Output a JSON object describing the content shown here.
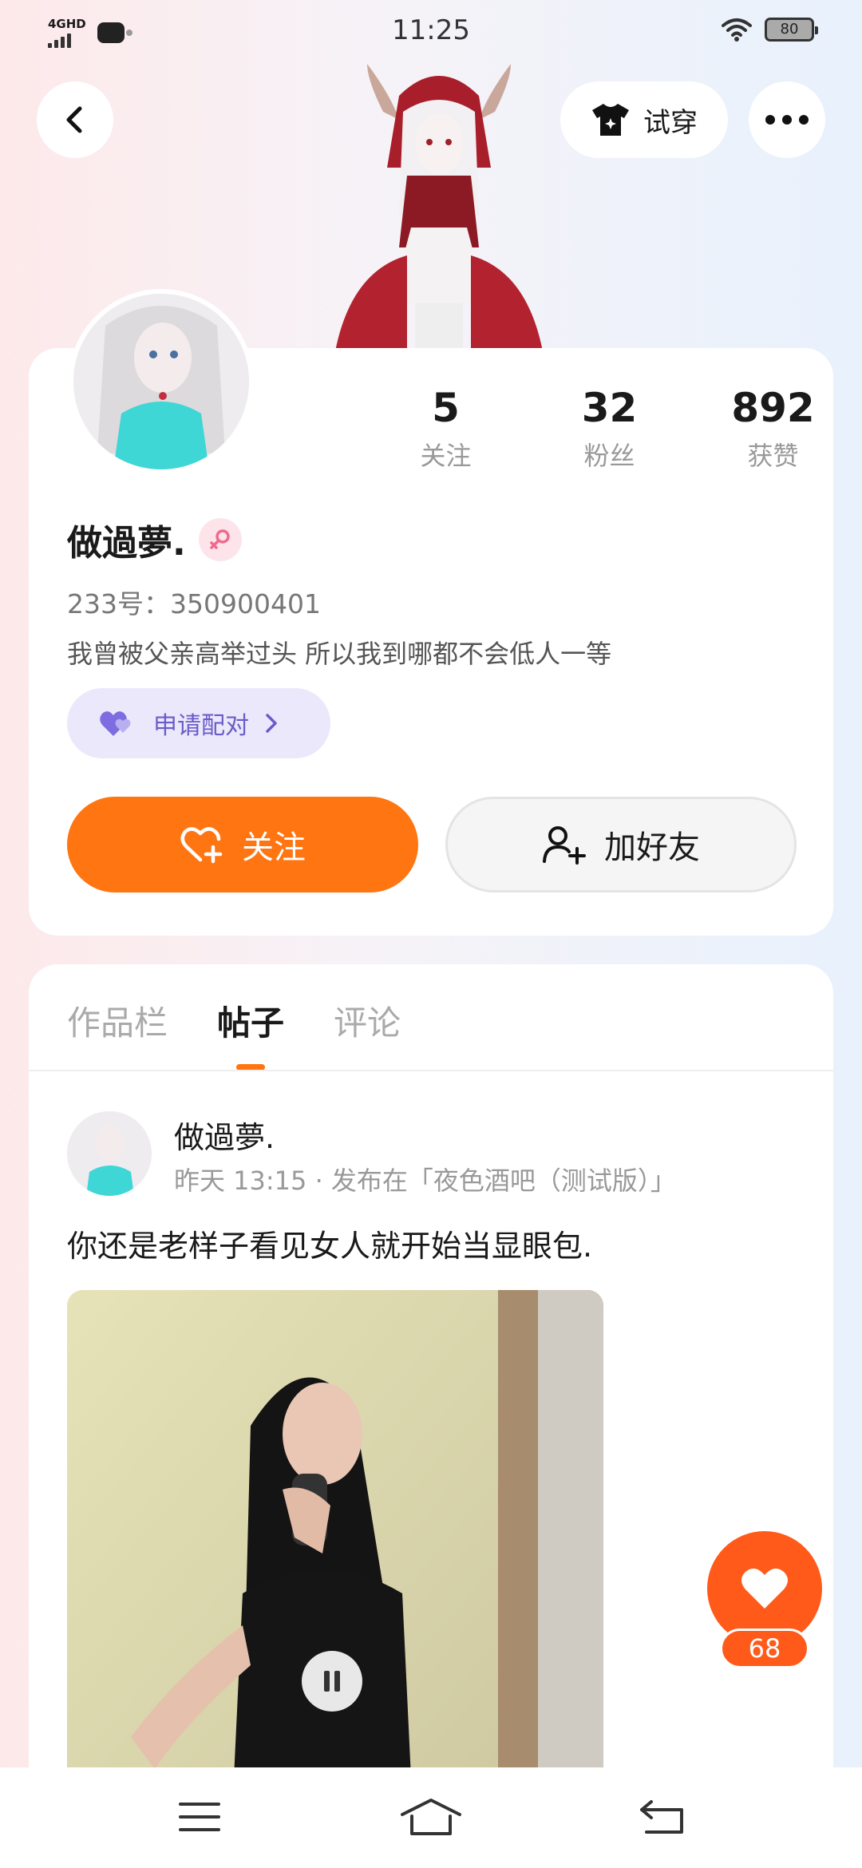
{
  "status_bar": {
    "network": "4GHD",
    "time": "11:25",
    "battery": "80"
  },
  "nav": {
    "try_on_label": "试穿"
  },
  "profile": {
    "stats": [
      {
        "value": "5",
        "label": "关注"
      },
      {
        "value": "32",
        "label": "粉丝"
      },
      {
        "value": "892",
        "label": "获赞"
      }
    ],
    "name": "做過夢.",
    "uid": "233号：350900401",
    "bio": "我曾被父亲高举过头 所以我到哪都不会低人一等",
    "pair_label": "申请配对",
    "follow_label": "关注",
    "add_friend_label": "加好友"
  },
  "tabs": [
    {
      "label": "作品栏",
      "active": false
    },
    {
      "label": "帖子",
      "active": true
    },
    {
      "label": "评论",
      "active": false
    }
  ],
  "post": {
    "author": "做過夢.",
    "meta": "昨天 13:15 · 发布在「夜色酒吧（测试版）」",
    "text": "你还是老样子看见女人就开始当显眼包."
  },
  "like": {
    "count": "68"
  },
  "colors": {
    "accent": "#ff7512",
    "like": "#ff5a1a",
    "pair": "#6a5cc9"
  }
}
